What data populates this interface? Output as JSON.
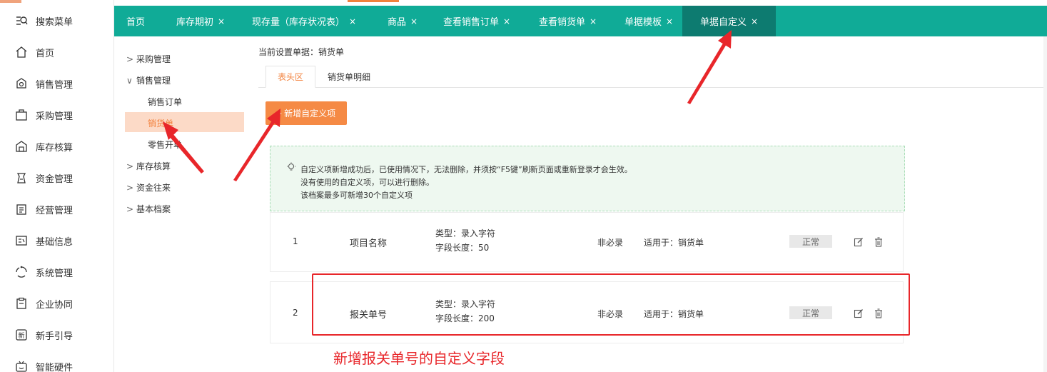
{
  "sidebar": {
    "items": [
      {
        "label": "搜索菜单",
        "icon": "search-menu-icon"
      },
      {
        "label": "首页",
        "icon": "home-icon"
      },
      {
        "label": "销售管理",
        "icon": "sales-icon"
      },
      {
        "label": "采购管理",
        "icon": "purchase-icon"
      },
      {
        "label": "库存核算",
        "icon": "warehouse-icon"
      },
      {
        "label": "资金管理",
        "icon": "money-icon"
      },
      {
        "label": "经营管理",
        "icon": "clipboard-icon"
      },
      {
        "label": "基础信息",
        "icon": "id-card-icon"
      },
      {
        "label": "系统管理",
        "icon": "system-icon"
      },
      {
        "label": "企业协同",
        "icon": "collab-icon"
      },
      {
        "label": "新手引导",
        "icon": "guide-icon"
      },
      {
        "label": "智能硬件",
        "icon": "hardware-icon"
      }
    ]
  },
  "tabs": [
    {
      "label": "首页",
      "closable": false
    },
    {
      "label": "库存期初",
      "closable": true
    },
    {
      "label": "现存量（库存状况表）",
      "closable": true
    },
    {
      "label": "商品",
      "closable": true
    },
    {
      "label": "查看销售订单",
      "closable": true
    },
    {
      "label": "查看销货单",
      "closable": true
    },
    {
      "label": "单据模板",
      "closable": true
    },
    {
      "label": "单据自定义",
      "closable": true,
      "active": true
    }
  ],
  "close_glyph": "×",
  "tree": {
    "items": [
      {
        "label": "采购管理",
        "caret": ">"
      },
      {
        "label": "销售管理",
        "caret": "∨"
      },
      {
        "label": "销售订单",
        "caret": ""
      },
      {
        "label": "销货单",
        "caret": "",
        "selected": true
      },
      {
        "label": "零售开单",
        "caret": ""
      },
      {
        "label": "库存核算",
        "caret": ">"
      },
      {
        "label": "资金往来",
        "caret": ">"
      },
      {
        "label": "基本档案",
        "caret": ">"
      }
    ]
  },
  "content": {
    "current_setting": "当前设置单据：销货单",
    "sub_tabs": [
      {
        "label": "表头区",
        "active": true
      },
      {
        "label": "销货单明细",
        "active": false
      }
    ],
    "add_button": "+ 新增自定义项",
    "notice_lines": [
      "自定义项新增成功后，已使用情况下，无法删除，并须按“F5键”刷新页面或重新登录才会生效。",
      "没有使用的自定义项，可以进行删除。",
      "该档案最多可新增30个自定义项"
    ],
    "fields": [
      {
        "index": "1",
        "name": "项目名称",
        "type": "类型：录入字符",
        "length": "字段长度：50",
        "required": "非必录",
        "applies": "适用于：销货单",
        "status": "正常"
      },
      {
        "index": "2",
        "name": "报关单号",
        "type": "类型：录入字符",
        "length": "字段长度：200",
        "required": "非必录",
        "applies": "适用于：销货单",
        "status": "正常"
      }
    ]
  },
  "annotation": {
    "caption": "新增报关单号的自定义字段"
  },
  "colors": {
    "tab_bar": "#10ab97",
    "tab_active": "#0d7b70",
    "accent_orange": "#f58a45",
    "selected_tree": "#fcdac7",
    "annotation_red": "#e8262a"
  }
}
